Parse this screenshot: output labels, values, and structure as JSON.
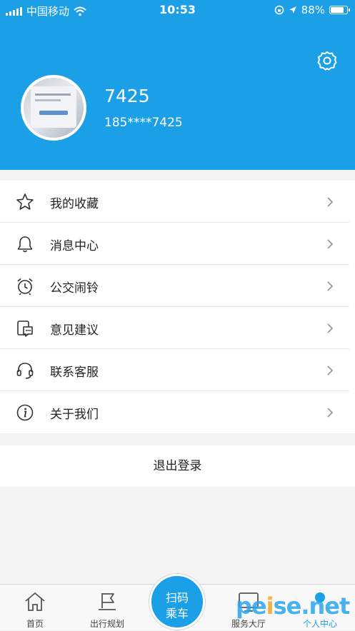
{
  "status_bar": {
    "carrier": "中国移动",
    "time": "10:53",
    "battery": "88%",
    "battery_level": 0.88
  },
  "profile": {
    "name": "7425",
    "phone": "185****7425"
  },
  "menu": {
    "items": [
      {
        "label": "我的收藏",
        "icon": "star-icon"
      },
      {
        "label": "消息中心",
        "icon": "bell-icon"
      },
      {
        "label": "公交闹铃",
        "icon": "alarm-clock-icon"
      },
      {
        "label": "意见建议",
        "icon": "feedback-icon"
      },
      {
        "label": "联系客服",
        "icon": "headset-icon"
      },
      {
        "label": "关于我们",
        "icon": "info-icon"
      }
    ]
  },
  "logout_label": "退出登录",
  "tabbar": {
    "tabs": [
      {
        "label": "首页",
        "icon": "home-icon"
      },
      {
        "label": "出行规划",
        "icon": "route-flag-icon"
      },
      {
        "label": "服务大厅",
        "icon": "service-hall-icon"
      },
      {
        "label": "个人中心",
        "icon": "person-icon"
      }
    ],
    "scan": {
      "line1": "扫码",
      "line2": "乘车"
    }
  },
  "watermark": {
    "part1": "pe",
    "dot": "i",
    "part2": "se.net"
  },
  "colors": {
    "primary": "#1ba0e8",
    "background": "#f4f4f4"
  }
}
